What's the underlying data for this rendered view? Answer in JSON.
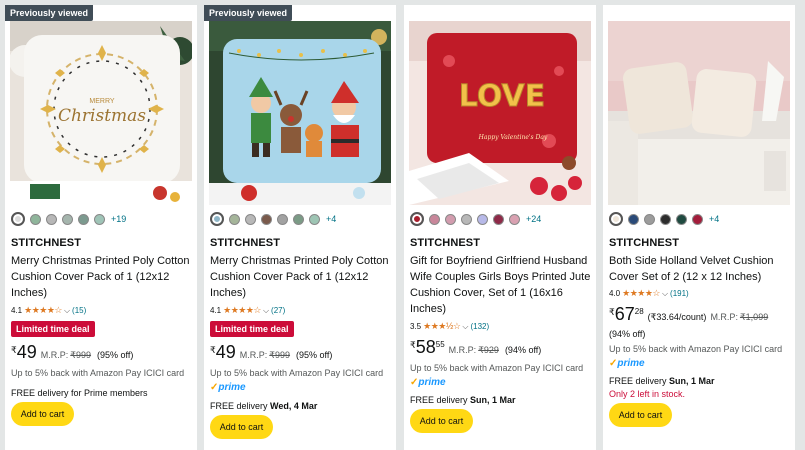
{
  "products": [
    {
      "badge": "Previously viewed",
      "swatch_colors": [
        "#dcdcdc",
        "#8fb59b",
        "#b7b7b7",
        "#a5b5ad",
        "#7c9a8f",
        "#9fc4b7"
      ],
      "more_colors": "+19",
      "brand": "STITCHNEST",
      "title": "Merry Christmas Printed Poly Cotton Cushion Cover Pack of 1 (12x12 Inches)",
      "rating_value": "4.1",
      "rating_stars": "★★★★☆",
      "rating_count": "(15)",
      "deal": "Limited time deal",
      "price_symbol": "₹",
      "price_whole": "49",
      "price_fraction": "",
      "mrp_label": "M.R.P:",
      "mrp_value": "₹999",
      "discount": "(95% off)",
      "unit_price": "",
      "cashback": "Up to 5% back with Amazon Pay ICICI card",
      "prime": "",
      "delivery_prefix": "FREE delivery for Prime members",
      "delivery_date": "",
      "stock": "",
      "add_to_cart": "Add to cart"
    },
    {
      "badge": "Previously viewed",
      "swatch_colors": [
        "#8fb6c8",
        "#a5b59a",
        "#b8b8b8",
        "#7a5a4c",
        "#a2a2a2",
        "#7b9b86",
        "#9ec5b4"
      ],
      "more_colors": "+4",
      "brand": "STITCHNEST",
      "title": "Merry Christmas Printed Poly Cotton Cushion Cover Pack of 1 (12x12 Inches)",
      "rating_value": "4.1",
      "rating_stars": "★★★★☆",
      "rating_count": "(27)",
      "deal": "Limited time deal",
      "price_symbol": "₹",
      "price_whole": "49",
      "price_fraction": "",
      "mrp_label": "M.R.P:",
      "mrp_value": "₹999",
      "discount": "(95% off)",
      "unit_price": "",
      "cashback": "Up to 5% back with Amazon Pay ICICI card",
      "prime": "prime",
      "delivery_prefix": "FREE delivery",
      "delivery_date": "Wed, 4 Mar",
      "stock": "",
      "add_to_cart": "Add to cart"
    },
    {
      "badge": "",
      "swatch_colors": [
        "#a81d2c",
        "#c8869a",
        "#d29cae",
        "#b8b8b8",
        "#b7b9e8",
        "#8e2a48",
        "#d9a1b1"
      ],
      "more_colors": "+24",
      "brand": "STITCHNEST",
      "title": "Gift for Boyfriend Girlfriend Husband Wife Couples Girls Boys Printed Jute Cushion Cover, Set of 1 (16x16 Inches)",
      "rating_value": "3.5",
      "rating_stars": "★★★½☆",
      "rating_count": "(132)",
      "deal": "",
      "price_symbol": "₹",
      "price_whole": "58",
      "price_fraction": "55",
      "mrp_label": "M.R.P:",
      "mrp_value": "₹929",
      "discount": "(94% off)",
      "unit_price": "",
      "cashback": "Up to 5% back with Amazon Pay ICICI card",
      "prime": "prime",
      "delivery_prefix": "FREE delivery",
      "delivery_date": "Sun, 1 Mar",
      "stock": "",
      "add_to_cart": "Add to cart"
    },
    {
      "badge": "",
      "swatch_colors": [
        "#efe6da",
        "#2a4a78",
        "#9c9c9c",
        "#2d2d2d",
        "#1f4a40",
        "#a31d3b"
      ],
      "more_colors": "+4",
      "brand": "STITCHNEST",
      "title": "Both Side Holland Velvet Cushion Cover Set of 2 (12 x 12 Inches)",
      "rating_value": "4.0",
      "rating_stars": "★★★★☆",
      "rating_count": "(191)",
      "deal": "",
      "price_symbol": "₹",
      "price_whole": "67",
      "price_fraction": "28",
      "mrp_label": "M.R.P:",
      "mrp_value": "₹1,099",
      "discount": "(94% off)",
      "unit_price": "(₹33.64/count)",
      "cashback": "Up to 5% back with Amazon Pay ICICI card",
      "prime": "prime",
      "delivery_prefix": "FREE delivery",
      "delivery_date": "Sun, 1 Mar",
      "stock": "Only 2 left in stock.",
      "add_to_cart": "Add to cart"
    }
  ],
  "image_text": {
    "p1_line1": "MERRY",
    "p1_line2": "Christmas",
    "p3_word": "LOVE",
    "p3_caption": "Happy Valentine's Day"
  },
  "accent_colors": {
    "link": "#007185",
    "deal": "#cc0c39",
    "button": "#ffd814",
    "star": "#de7921",
    "prime": "#1a98ff"
  }
}
